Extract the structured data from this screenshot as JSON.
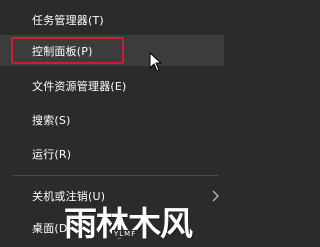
{
  "menu": {
    "items": [
      {
        "label": "任务管理器(T)"
      },
      {
        "label": "控制面板(P)"
      },
      {
        "label": "文件资源管理器(E)"
      },
      {
        "label": "搜索(S)"
      },
      {
        "label": "运行(R)"
      },
      {
        "label": "关机或注销(U)",
        "has_submenu": true
      },
      {
        "label": "桌面(D)"
      }
    ]
  },
  "highlight_color": "#c91f2e",
  "watermark": {
    "text": "雨林木风",
    "sub": "YLMF"
  }
}
